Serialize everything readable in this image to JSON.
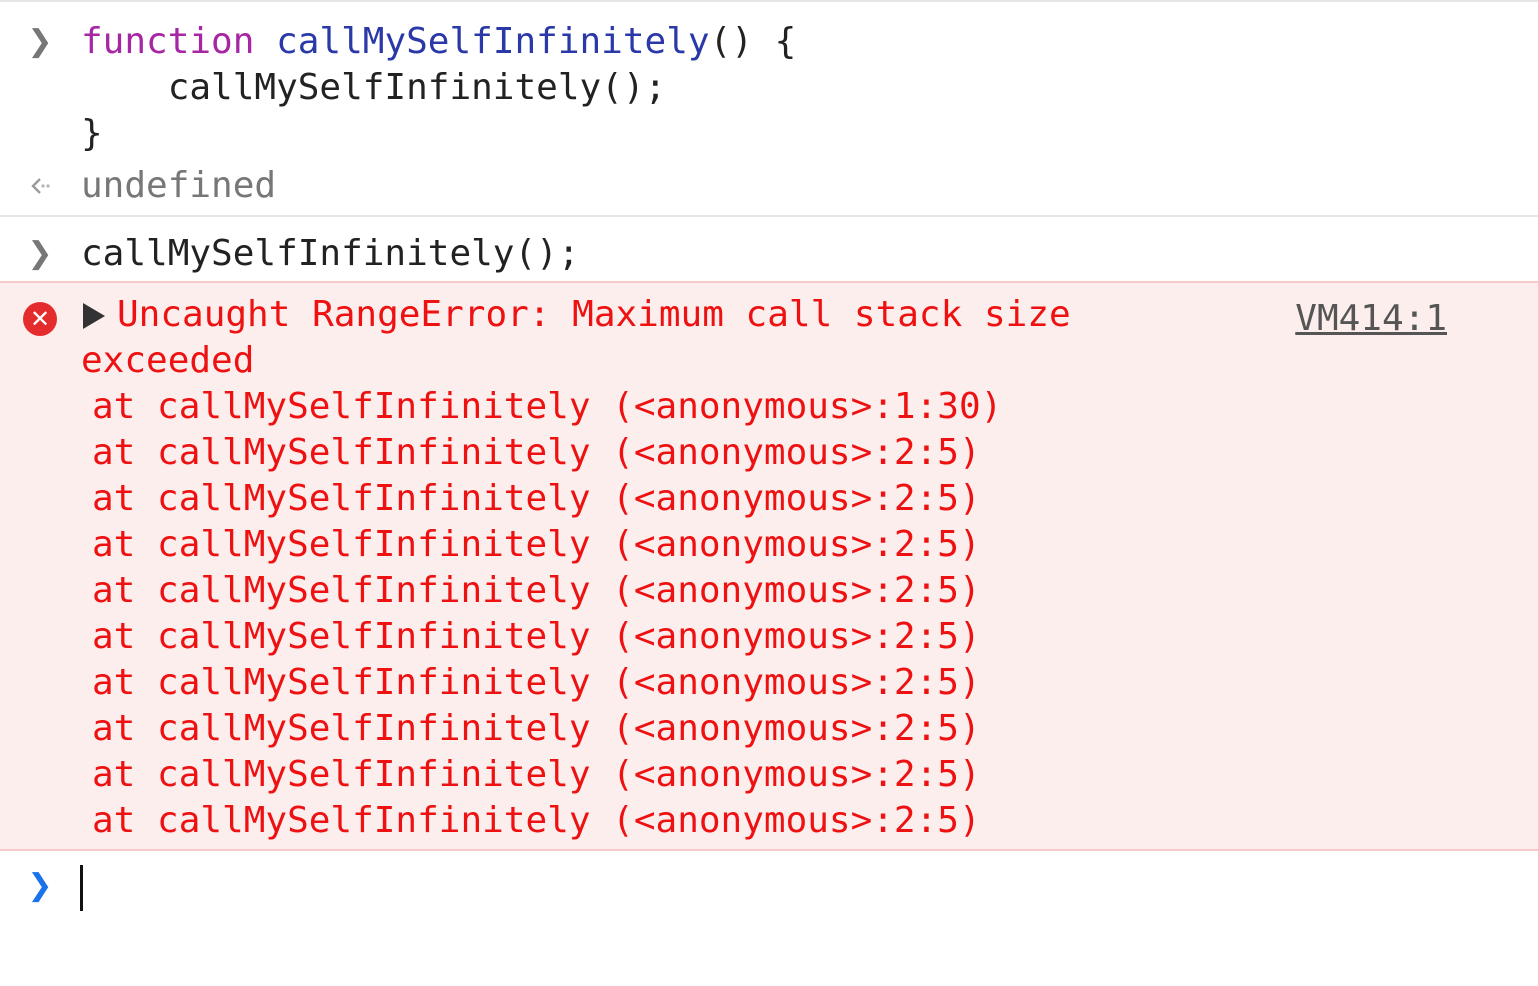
{
  "console": {
    "input1": {
      "line1": {
        "keyword": "function",
        "name": "callMySelfInfinitely",
        "rest": "() {"
      },
      "line2": "    callMySelfInfinitely();",
      "line3": "}"
    },
    "result1": "undefined",
    "input2": "callMySelfInfinitely();",
    "error": {
      "message_line1": "Uncaught RangeError: Maximum call stack size",
      "message_line2": "exceeded",
      "source": "VM414:1",
      "stack": [
        "at callMySelfInfinitely (<anonymous>:1:30)",
        "at callMySelfInfinitely (<anonymous>:2:5)",
        "at callMySelfInfinitely (<anonymous>:2:5)",
        "at callMySelfInfinitely (<anonymous>:2:5)",
        "at callMySelfInfinitely (<anonymous>:2:5)",
        "at callMySelfInfinitely (<anonymous>:2:5)",
        "at callMySelfInfinitely (<anonymous>:2:5)",
        "at callMySelfInfinitely (<anonymous>:2:5)",
        "at callMySelfInfinitely (<anonymous>:2:5)",
        "at callMySelfInfinitely (<anonymous>:2:5)"
      ]
    },
    "icons": {
      "input_prompt": "chevron-right-icon",
      "result_marker": "return-arrow-icon",
      "error": "error-circle-icon",
      "expand": "disclosure-triangle-icon",
      "active_prompt": "chevron-right-icon"
    },
    "colors": {
      "error_text": "#ee1111",
      "error_background": "#fdeeee",
      "keyword": "#a626a4",
      "function_name": "#2a38a8",
      "prompt_active": "#1a73e8"
    }
  }
}
